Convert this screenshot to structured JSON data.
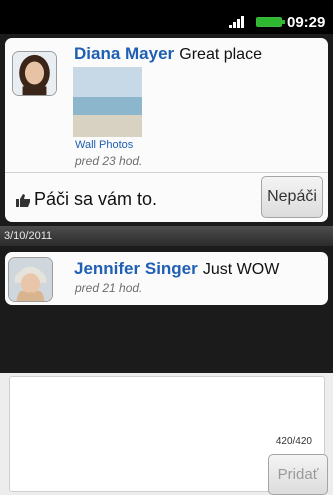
{
  "status_bar": {
    "time": "09:29"
  },
  "feed": {
    "post1": {
      "author": "Diana Mayer",
      "message": "Great place",
      "photo_album": "Wall Photos",
      "time": "pred 23 hod."
    },
    "like_text": "Páči sa vám to.",
    "unlike_label": "Nepáči",
    "date_separator": "3/10/2011",
    "post2": {
      "author": "Jennifer Singer",
      "message": "Just WOW",
      "time": "pred 21 hod."
    }
  },
  "compose": {
    "counter": "420/420",
    "post_label": "Pridať"
  },
  "icons": [
    "signal-icon",
    "battery-icon",
    "thumbs-up-icon"
  ],
  "colors": {
    "link": "#1f5fb4",
    "battery": "#2fb82f"
  }
}
